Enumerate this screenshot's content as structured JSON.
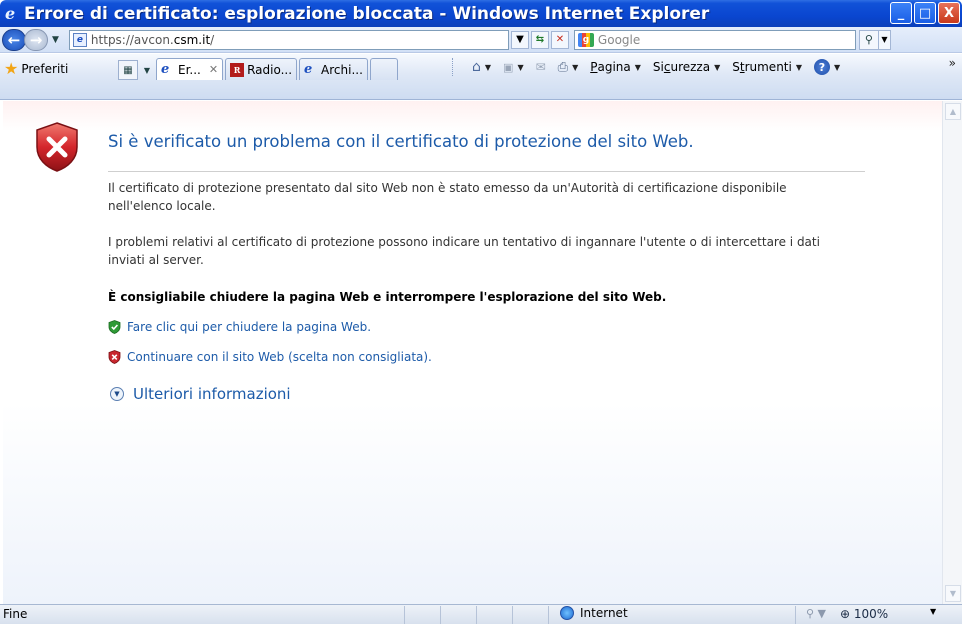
{
  "window": {
    "title": "Errore di certificato: esplorazione bloccata - Windows Internet Explorer",
    "icon": "ie-icon",
    "controls": [
      "_",
      "□",
      "X"
    ]
  },
  "address_bar": {
    "url_prefix": "https://avcon.",
    "url_host": "csm.it",
    "url_suffix": "/",
    "search_placeholder": "Google"
  },
  "command_bar": {
    "favorites_label": "Preferiti",
    "tabs": [
      {
        "label": "Er...",
        "icon": "ie-icon",
        "active": true
      },
      {
        "label": "Radio...",
        "icon": "radio-icon",
        "active": false
      },
      {
        "label": "Archi...",
        "icon": "ie-icon",
        "active": false
      }
    ],
    "commands": {
      "page": "Pagina",
      "page_u": "P",
      "page_rest": "agina",
      "security_pre": "Si",
      "security_u": "c",
      "security_rest": "urezza",
      "tools_pre": "S",
      "tools_u": "t",
      "tools_rest": "rumenti"
    }
  },
  "content": {
    "title": "Si è verificato un problema con il certificato di protezione del sito Web.",
    "paragraph1": "Il certificato di protezione presentato dal sito Web non è stato emesso da un'Autorità di certificazione disponibile nell'elenco locale.",
    "paragraph2": "I problemi relativi al certificato di protezione possono indicare un tentativo di ingannare l'utente o di intercettare i dati inviati al server.",
    "advice": "È consigliabile chiudere la pagina Web e interrompere l'esplorazione del sito Web.",
    "close_link": "Fare clic qui per chiudere la pagina Web.",
    "continue_link": "Continuare con il sito Web (scelta non consigliata).",
    "more_info": "Ulteriori informazioni"
  },
  "status_bar": {
    "status_text": "Fine",
    "zone": "Internet",
    "zoom": "100%"
  },
  "colors": {
    "title_bar": "#0a46d0",
    "link": "#1d5ba9",
    "error_red": "#c8262e",
    "ok_green": "#2e9a36"
  }
}
